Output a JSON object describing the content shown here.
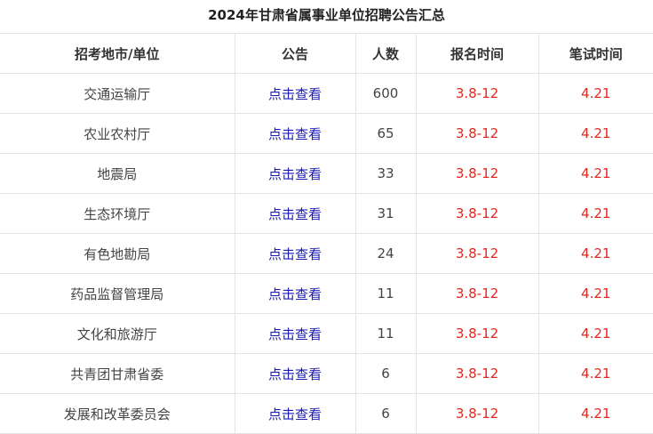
{
  "title": "2024年甘肃省属事业单位招聘公告汇总",
  "headers": [
    "招考地市/单位",
    "公告",
    "人数",
    "报名时间",
    "笔试时间"
  ],
  "rows": [
    {
      "unit": "交通运输厅",
      "link": "点击查看",
      "count": "600",
      "signup": "3.8-12",
      "exam": "4.21"
    },
    {
      "unit": "农业农村厅",
      "link": "点击查看",
      "count": "65",
      "signup": "3.8-12",
      "exam": "4.21"
    },
    {
      "unit": "地震局",
      "link": "点击查看",
      "count": "33",
      "signup": "3.8-12",
      "exam": "4.21"
    },
    {
      "unit": "生态环境厅",
      "link": "点击查看",
      "count": "31",
      "signup": "3.8-12",
      "exam": "4.21"
    },
    {
      "unit": "有色地勘局",
      "link": "点击查看",
      "count": "24",
      "signup": "3.8-12",
      "exam": "4.21"
    },
    {
      "unit": "药品监督管理局",
      "link": "点击查看",
      "count": "11",
      "signup": "3.8-12",
      "exam": "4.21"
    },
    {
      "unit": "文化和旅游厅",
      "link": "点击查看",
      "count": "11",
      "signup": "3.8-12",
      "exam": "4.21"
    },
    {
      "unit": "共青团甘肃省委",
      "link": "点击查看",
      "count": "6",
      "signup": "3.8-12",
      "exam": "4.21"
    },
    {
      "unit": "发展和改革委员会",
      "link": "点击查看",
      "count": "6",
      "signup": "3.8-12",
      "exam": "4.21"
    }
  ],
  "colors": {
    "link": "#1a1ab8",
    "date": "#e0281e",
    "border": "#e4e4e4"
  }
}
